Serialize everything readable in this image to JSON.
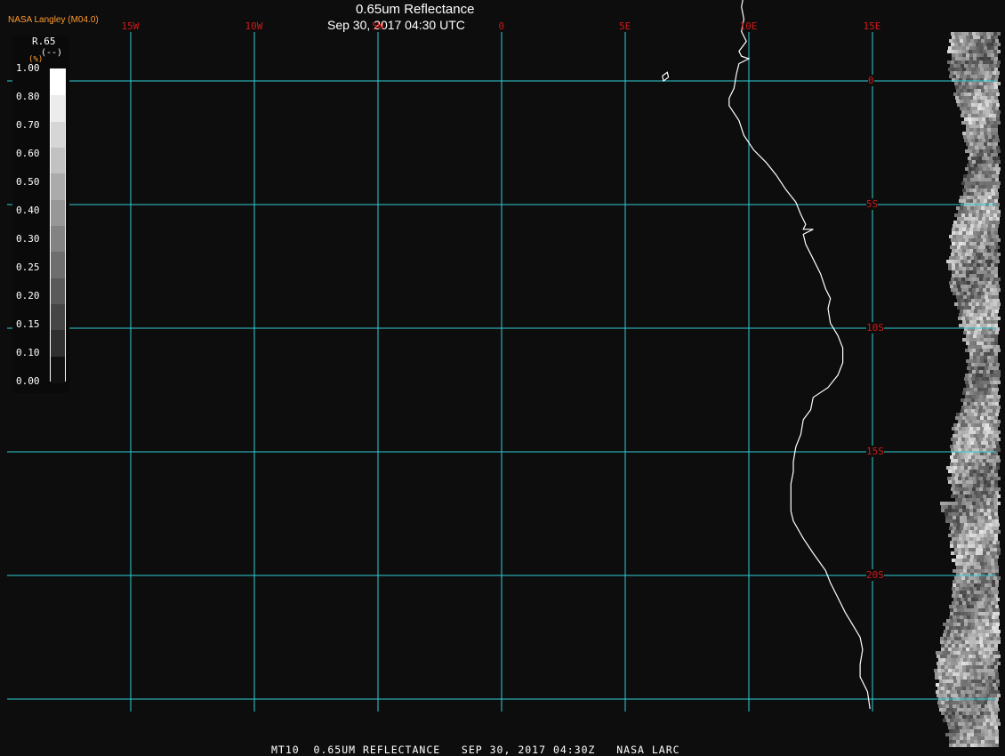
{
  "header": {
    "title": "0.65um Reflectance",
    "subtitle": "Sep 30, 2017 04:30 UTC",
    "credit": "NASA Langley (M04.0)"
  },
  "footer": {
    "text": "MT10  0.65UM REFLECTANCE   SEP 30, 2017 04:30Z   NASA LARC"
  },
  "map": {
    "background": "#0d0d0d",
    "grid_color": "#2fd0d8",
    "coastline_color": "#ffffff",
    "label_color": "#cc1a1a",
    "longitudes": [
      {
        "label": "15W",
        "deg": -15
      },
      {
        "label": "10W",
        "deg": -10
      },
      {
        "label": "5W",
        "deg": -5
      },
      {
        "label": "0",
        "deg": 0
      },
      {
        "label": "5E",
        "deg": 5
      },
      {
        "label": "10E",
        "deg": 10
      },
      {
        "label": "15E",
        "deg": 15
      }
    ],
    "latitudes": [
      {
        "label": "0",
        "deg": 0
      },
      {
        "label": "5S",
        "deg": -5
      },
      {
        "label": "10S",
        "deg": -10
      },
      {
        "label": "15S",
        "deg": -15
      },
      {
        "label": "20S",
        "deg": -20
      },
      {
        "label": "",
        "deg": -25
      }
    ],
    "coastline": [
      [
        9.9,
        4.0
      ],
      [
        9.8,
        3.5
      ],
      [
        9.7,
        3.0
      ],
      [
        9.8,
        2.5
      ],
      [
        9.7,
        2.0
      ],
      [
        9.9,
        1.6
      ],
      [
        9.6,
        1.2
      ],
      [
        9.7,
        1.0
      ],
      [
        10.0,
        0.9
      ],
      [
        9.6,
        0.7
      ],
      [
        9.5,
        0.3
      ],
      [
        9.4,
        -0.3
      ],
      [
        9.2,
        -0.7
      ],
      [
        9.2,
        -1.0
      ],
      [
        9.6,
        -1.6
      ],
      [
        9.8,
        -2.2
      ],
      [
        10.2,
        -2.8
      ],
      [
        10.7,
        -3.3
      ],
      [
        11.1,
        -3.8
      ],
      [
        11.5,
        -4.4
      ],
      [
        11.9,
        -4.9
      ],
      [
        12.1,
        -5.4
      ],
      [
        12.3,
        -5.8
      ],
      [
        12.2,
        -6.0
      ],
      [
        12.6,
        -6.0
      ],
      [
        12.2,
        -6.2
      ],
      [
        12.3,
        -6.6
      ],
      [
        12.6,
        -7.2
      ],
      [
        12.9,
        -7.8
      ],
      [
        13.1,
        -8.4
      ],
      [
        13.3,
        -8.8
      ],
      [
        13.2,
        -9.2
      ],
      [
        13.3,
        -9.8
      ],
      [
        13.6,
        -10.3
      ],
      [
        13.8,
        -10.8
      ],
      [
        13.8,
        -11.4
      ],
      [
        13.6,
        -11.9
      ],
      [
        13.2,
        -12.4
      ],
      [
        12.6,
        -12.8
      ],
      [
        12.5,
        -13.3
      ],
      [
        12.2,
        -13.7
      ],
      [
        12.1,
        -14.3
      ],
      [
        11.9,
        -14.8
      ],
      [
        11.8,
        -15.4
      ],
      [
        11.8,
        -15.8
      ],
      [
        11.7,
        -16.3
      ],
      [
        11.7,
        -16.8
      ],
      [
        11.7,
        -17.4
      ],
      [
        11.8,
        -17.8
      ],
      [
        12.2,
        -18.5
      ],
      [
        12.6,
        -19.1
      ],
      [
        13.1,
        -19.8
      ],
      [
        13.3,
        -20.3
      ],
      [
        13.6,
        -20.9
      ],
      [
        13.9,
        -21.5
      ],
      [
        14.2,
        -22.0
      ],
      [
        14.5,
        -22.5
      ],
      [
        14.6,
        -23.0
      ],
      [
        14.5,
        -23.6
      ],
      [
        14.5,
        -24.1
      ],
      [
        14.8,
        -24.7
      ],
      [
        14.9,
        -25.4
      ]
    ],
    "island": [
      [
        6.5,
        0.2
      ],
      [
        6.7,
        0.35
      ],
      [
        6.75,
        0.15
      ],
      [
        6.55,
        0.0
      ],
      [
        6.5,
        0.2
      ]
    ]
  },
  "legend": {
    "variable": "R.65",
    "unit": "(--)",
    "pct_label": "(%)",
    "ticks": [
      "1.00",
      "0.80",
      "0.70",
      "0.60",
      "0.50",
      "0.40",
      "0.30",
      "0.25",
      "0.20",
      "0.15",
      "0.10",
      "0.00"
    ],
    "colors": [
      "#ffffff",
      "#ececec",
      "#d6d6d6",
      "#c2c2c2",
      "#ababab",
      "#979797",
      "#838383",
      "#6e6e6e",
      "#5a5a5a",
      "#464646",
      "#303030",
      "#111111"
    ]
  }
}
